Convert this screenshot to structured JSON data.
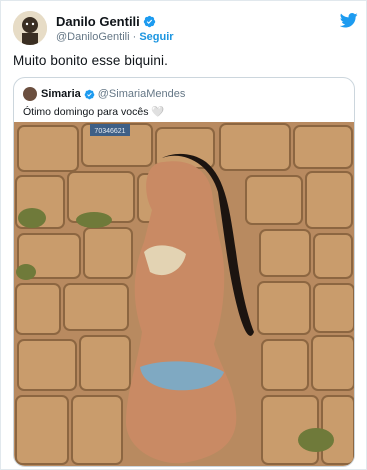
{
  "tweet": {
    "author_name": "Danilo Gentili",
    "author_handle": "@DaniloGentili",
    "separator": "·",
    "follow_label": "Seguir",
    "text": "Muito bonito esse biquini."
  },
  "quoted_tweet": {
    "author_name": "Simaria",
    "author_handle": "@SimariaMendes",
    "text": "Ótimo domingo para vocês",
    "emoji": "🤍",
    "sign_text": "70346621"
  },
  "colors": {
    "accent": "#1d9bf0",
    "text": "#0f1419",
    "muted": "#657786",
    "border": "#ccd6dd"
  },
  "icons": {
    "verified": "verified-badge-icon",
    "logo": "twitter-bird-icon"
  }
}
